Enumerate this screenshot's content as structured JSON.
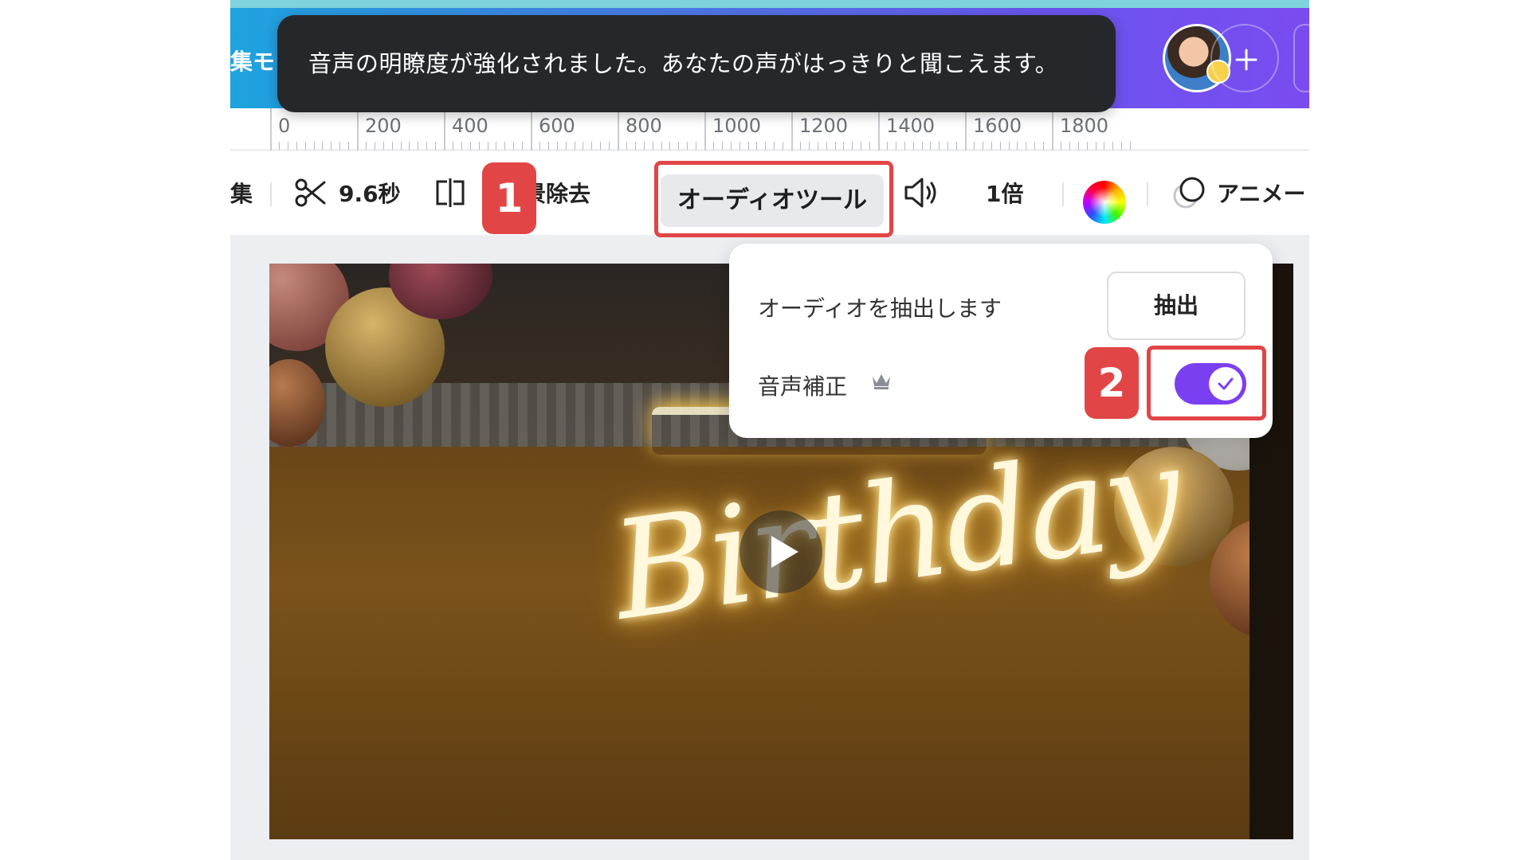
{
  "header": {
    "partial_mode_label": "集モ"
  },
  "toast": {
    "message": "音声の明瞭度が強化されました。あなたの声がはっきりと聞こえます。"
  },
  "ruler": {
    "labels": [
      "0",
      "200",
      "400",
      "600",
      "800",
      "1000",
      "1200",
      "1400",
      "1600",
      "1800"
    ]
  },
  "toolbar": {
    "partial_edit_label": "集",
    "duration_label": "9.6秒",
    "bg_remove_label": "背景除去",
    "audio_tools_label": "オーディオツール",
    "speed_label": "1倍",
    "animate_label": "アニメー"
  },
  "popover": {
    "extract_label": "オーディオを抽出します",
    "extract_button": "抽出",
    "enhance_label": "音声補正",
    "enhance_enabled": true
  },
  "steps": {
    "step1": "1",
    "step2": "2"
  },
  "colors": {
    "accent_purple": "#7b3ff2",
    "highlight_red": "#e24545",
    "toast_bg": "#26272b"
  }
}
